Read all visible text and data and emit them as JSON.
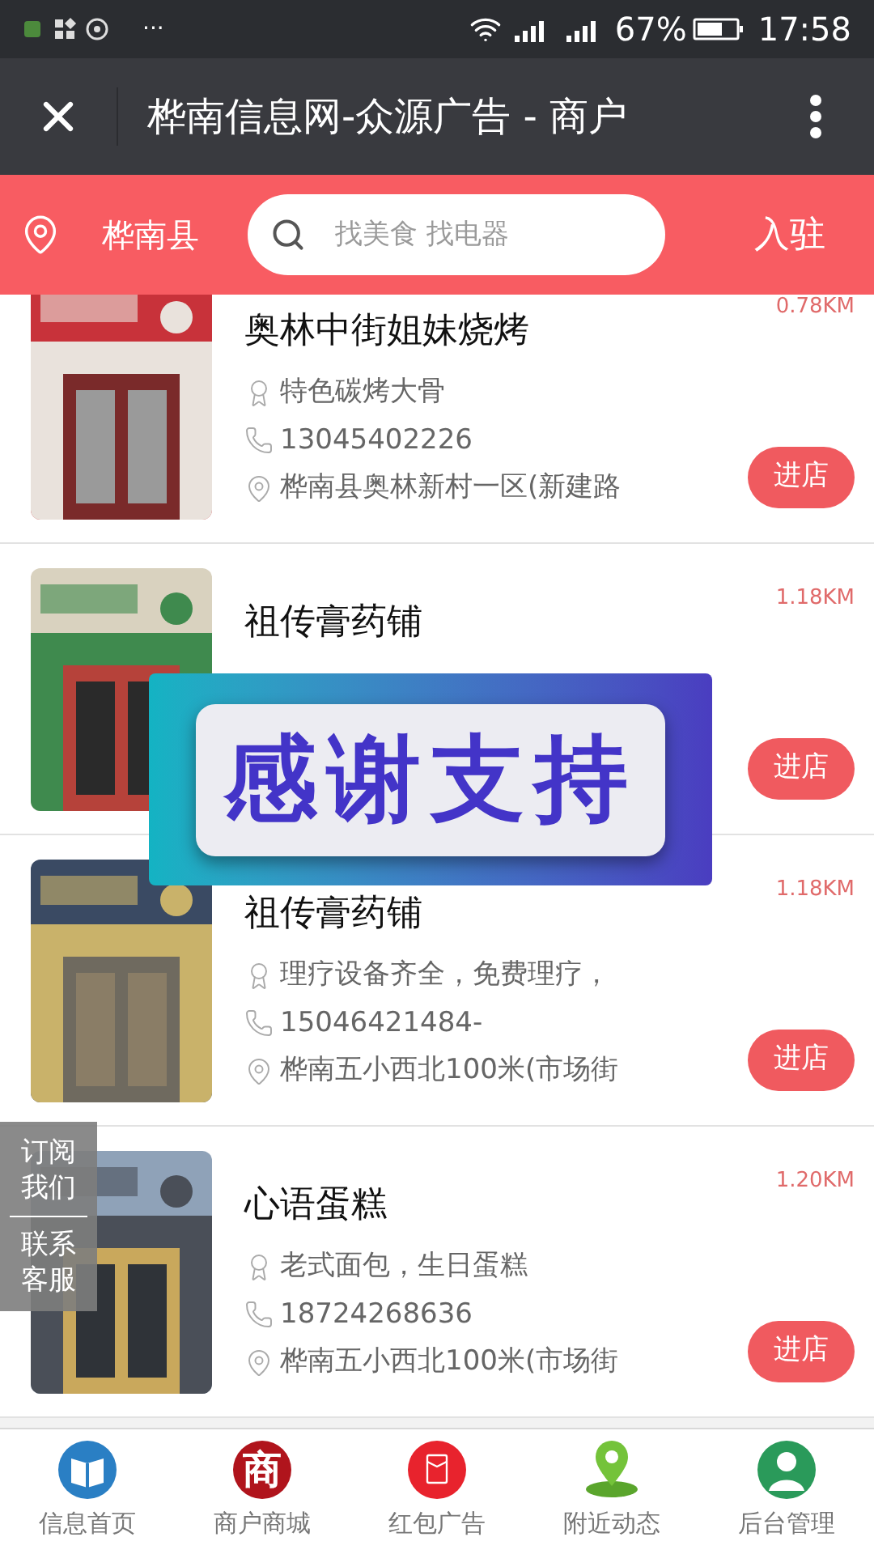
{
  "status_bar": {
    "dots": "···",
    "battery": "67%",
    "time": "17:58"
  },
  "title_bar": {
    "title": "桦南信息网-众源广告 - 商户"
  },
  "search_bar": {
    "location": "桦南县",
    "placeholder": "找美食 找电器",
    "join": "入驻"
  },
  "stores": [
    {
      "name": "奥林中街姐妹烧烤",
      "distance": "0.78KM",
      "feature": "特色碳烤大骨",
      "phone": "13045402226",
      "address": "桦南县奥林新村一区(新建路",
      "button": "进店"
    },
    {
      "name": "祖传膏药铺",
      "distance": "1.18KM",
      "button": "进店"
    },
    {
      "name": "祖传膏药铺",
      "distance": "1.18KM",
      "feature": "理疗设备齐全，免费理疗，",
      "phone": "15046421484-",
      "address": "桦南五小西北100米(市场街",
      "button": "进店"
    },
    {
      "name": "心语蛋糕",
      "distance": "1.20KM",
      "feature": "老式面包，生日蛋糕",
      "phone": "18724268636",
      "address": "桦南五小西北100米(市场街",
      "button": "进店"
    }
  ],
  "side_panel": [
    {
      "label": "订阅我们"
    },
    {
      "label": "联系客服"
    }
  ],
  "banner": {
    "text": "感谢支持"
  },
  "bottom_nav": [
    {
      "label": "信息首页",
      "kind": "book"
    },
    {
      "label": "商户商城",
      "kind": "glyph",
      "glyph": "商"
    },
    {
      "label": "红包广告",
      "kind": "envelope"
    },
    {
      "label": "附近动态",
      "kind": "pin"
    },
    {
      "label": "后台管理",
      "kind": "person"
    }
  ]
}
